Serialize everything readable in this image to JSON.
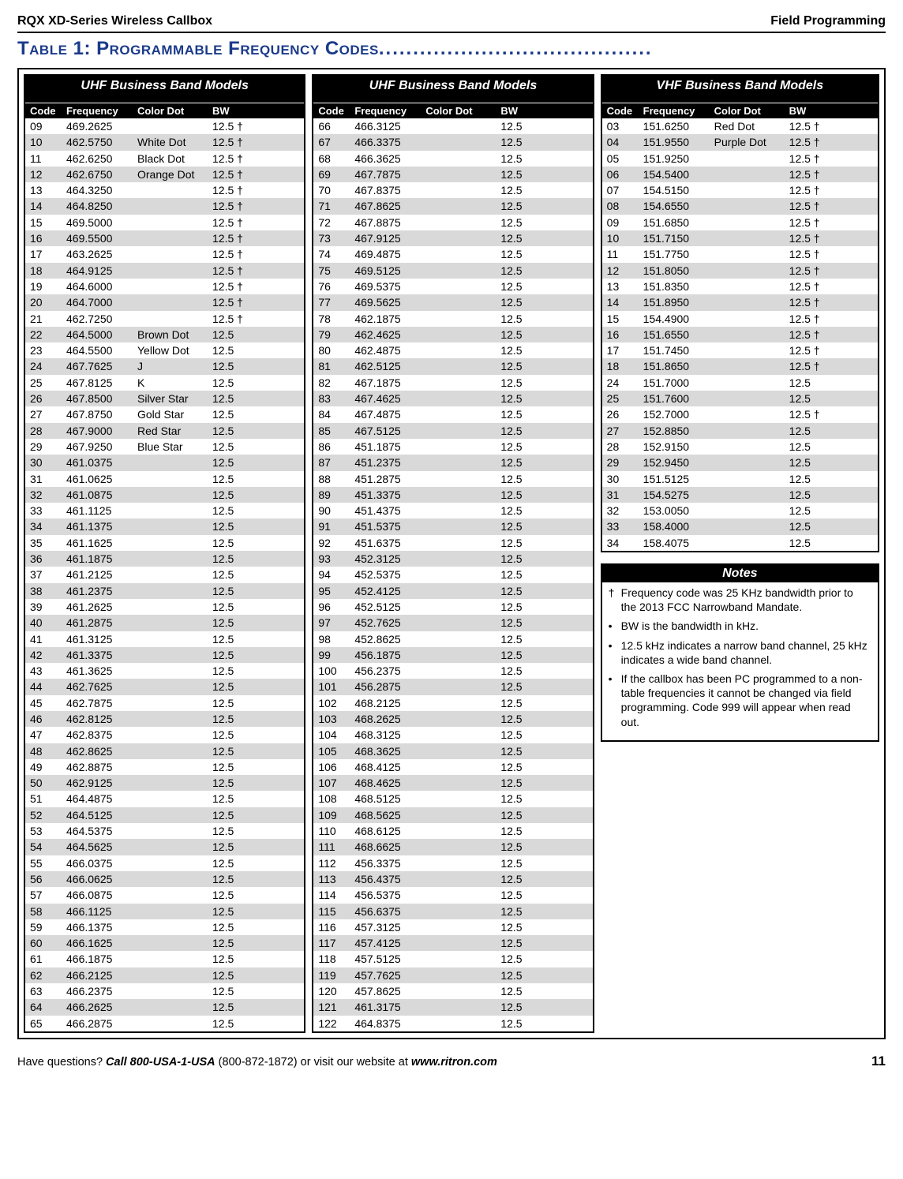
{
  "header": {
    "left": "RQX XD-Series Wireless Callbox",
    "right": "Field Programming"
  },
  "title": "Table 1: Programmable Frequency Codes",
  "dots": "........................................",
  "tables": {
    "headers": [
      "Code",
      "Frequency",
      "Color Dot",
      "BW"
    ],
    "col1": {
      "title": "UHF Business Band Models",
      "rows": [
        [
          "09",
          "469.2625",
          "",
          "12.5 †"
        ],
        [
          "10",
          "462.5750",
          "White Dot",
          "12.5 †"
        ],
        [
          "11",
          "462.6250",
          "Black Dot",
          "12.5 †"
        ],
        [
          "12",
          "462.6750",
          "Orange Dot",
          "12.5 †"
        ],
        [
          "13",
          "464.3250",
          "",
          "12.5 †"
        ],
        [
          "14",
          "464.8250",
          "",
          "12.5 †"
        ],
        [
          "15",
          "469.5000",
          "",
          "12.5 †"
        ],
        [
          "16",
          "469.5500",
          "",
          "12.5 †"
        ],
        [
          "17",
          "463.2625",
          "",
          "12.5 †"
        ],
        [
          "18",
          "464.9125",
          "",
          "12.5 †"
        ],
        [
          "19",
          "464.6000",
          "",
          "12.5 †"
        ],
        [
          "20",
          "464.7000",
          "",
          "12.5 †"
        ],
        [
          "21",
          "462.7250",
          "",
          "12.5 †"
        ],
        [
          "22",
          "464.5000",
          "Brown Dot",
          "12.5"
        ],
        [
          "23",
          "464.5500",
          "Yellow Dot",
          "12.5"
        ],
        [
          "24",
          "467.7625",
          "J",
          "12.5"
        ],
        [
          "25",
          "467.8125",
          "K",
          "12.5"
        ],
        [
          "26",
          "467.8500",
          "Silver Star",
          "12.5"
        ],
        [
          "27",
          "467.8750",
          "Gold Star",
          "12.5"
        ],
        [
          "28",
          "467.9000",
          "Red Star",
          "12.5"
        ],
        [
          "29",
          "467.9250",
          "Blue Star",
          "12.5"
        ],
        [
          "30",
          "461.0375",
          "",
          "12.5"
        ],
        [
          "31",
          "461.0625",
          "",
          "12.5"
        ],
        [
          "32",
          "461.0875",
          "",
          "12.5"
        ],
        [
          "33",
          "461.1125",
          "",
          "12.5"
        ],
        [
          "34",
          "461.1375",
          "",
          "12.5"
        ],
        [
          "35",
          "461.1625",
          "",
          "12.5"
        ],
        [
          "36",
          "461.1875",
          "",
          "12.5"
        ],
        [
          "37",
          "461.2125",
          "",
          "12.5"
        ],
        [
          "38",
          "461.2375",
          "",
          "12.5"
        ],
        [
          "39",
          "461.2625",
          "",
          "12.5"
        ],
        [
          "40",
          "461.2875",
          "",
          "12.5"
        ],
        [
          "41",
          "461.3125",
          "",
          "12.5"
        ],
        [
          "42",
          "461.3375",
          "",
          "12.5"
        ],
        [
          "43",
          "461.3625",
          "",
          "12.5"
        ],
        [
          "44",
          "462.7625",
          "",
          "12.5"
        ],
        [
          "45",
          "462.7875",
          "",
          "12.5"
        ],
        [
          "46",
          "462.8125",
          "",
          "12.5"
        ],
        [
          "47",
          "462.8375",
          "",
          "12.5"
        ],
        [
          "48",
          "462.8625",
          "",
          "12.5"
        ],
        [
          "49",
          "462.8875",
          "",
          "12.5"
        ],
        [
          "50",
          "462.9125",
          "",
          "12.5"
        ],
        [
          "51",
          "464.4875",
          "",
          "12.5"
        ],
        [
          "52",
          "464.5125",
          "",
          "12.5"
        ],
        [
          "53",
          "464.5375",
          "",
          "12.5"
        ],
        [
          "54",
          "464.5625",
          "",
          "12.5"
        ],
        [
          "55",
          "466.0375",
          "",
          "12.5"
        ],
        [
          "56",
          "466.0625",
          "",
          "12.5"
        ],
        [
          "57",
          "466.0875",
          "",
          "12.5"
        ],
        [
          "58",
          "466.1125",
          "",
          "12.5"
        ],
        [
          "59",
          "466.1375",
          "",
          "12.5"
        ],
        [
          "60",
          "466.1625",
          "",
          "12.5"
        ],
        [
          "61",
          "466.1875",
          "",
          "12.5"
        ],
        [
          "62",
          "466.2125",
          "",
          "12.5"
        ],
        [
          "63",
          "466.2375",
          "",
          "12.5"
        ],
        [
          "64",
          "466.2625",
          "",
          "12.5"
        ],
        [
          "65",
          "466.2875",
          "",
          "12.5"
        ]
      ]
    },
    "col2": {
      "title": "UHF Business Band Models",
      "rows": [
        [
          "66",
          "466.3125",
          "",
          "12.5"
        ],
        [
          "67",
          "466.3375",
          "",
          "12.5"
        ],
        [
          "68",
          "466.3625",
          "",
          "12.5"
        ],
        [
          "69",
          "467.7875",
          "",
          "12.5"
        ],
        [
          "70",
          "467.8375",
          "",
          "12.5"
        ],
        [
          "71",
          "467.8625",
          "",
          "12.5"
        ],
        [
          "72",
          "467.8875",
          "",
          "12.5"
        ],
        [
          "73",
          "467.9125",
          "",
          "12.5"
        ],
        [
          "74",
          "469.4875",
          "",
          "12.5"
        ],
        [
          "75",
          "469.5125",
          "",
          "12.5"
        ],
        [
          "76",
          "469.5375",
          "",
          "12.5"
        ],
        [
          "77",
          "469.5625",
          "",
          "12.5"
        ],
        [
          "78",
          "462.1875",
          "",
          "12.5"
        ],
        [
          "79",
          "462.4625",
          "",
          "12.5"
        ],
        [
          "80",
          "462.4875",
          "",
          "12.5"
        ],
        [
          "81",
          "462.5125",
          "",
          "12.5"
        ],
        [
          "82",
          "467.1875",
          "",
          "12.5"
        ],
        [
          "83",
          "467.4625",
          "",
          "12.5"
        ],
        [
          "84",
          "467.4875",
          "",
          "12.5"
        ],
        [
          "85",
          "467.5125",
          "",
          "12.5"
        ],
        [
          "86",
          "451.1875",
          "",
          "12.5"
        ],
        [
          "87",
          "451.2375",
          "",
          "12.5"
        ],
        [
          "88",
          "451.2875",
          "",
          "12.5"
        ],
        [
          "89",
          "451.3375",
          "",
          "12.5"
        ],
        [
          "90",
          "451.4375",
          "",
          "12.5"
        ],
        [
          "91",
          "451.5375",
          "",
          "12.5"
        ],
        [
          "92",
          "451.6375",
          "",
          "12.5"
        ],
        [
          "93",
          "452.3125",
          "",
          "12.5"
        ],
        [
          "94",
          "452.5375",
          "",
          "12.5"
        ],
        [
          "95",
          "452.4125",
          "",
          "12.5"
        ],
        [
          "96",
          "452.5125",
          "",
          "12.5"
        ],
        [
          "97",
          "452.7625",
          "",
          "12.5"
        ],
        [
          "98",
          "452.8625",
          "",
          "12.5"
        ],
        [
          "99",
          "456.1875",
          "",
          "12.5"
        ],
        [
          "100",
          "456.2375",
          "",
          "12.5"
        ],
        [
          "101",
          "456.2875",
          "",
          "12.5"
        ],
        [
          "102",
          "468.2125",
          "",
          "12.5"
        ],
        [
          "103",
          "468.2625",
          "",
          "12.5"
        ],
        [
          "104",
          "468.3125",
          "",
          "12.5"
        ],
        [
          "105",
          "468.3625",
          "",
          "12.5"
        ],
        [
          "106",
          "468.4125",
          "",
          "12.5"
        ],
        [
          "107",
          "468.4625",
          "",
          "12.5"
        ],
        [
          "108",
          "468.5125",
          "",
          "12.5"
        ],
        [
          "109",
          "468.5625",
          "",
          "12.5"
        ],
        [
          "110",
          "468.6125",
          "",
          "12.5"
        ],
        [
          "111",
          "468.6625",
          "",
          "12.5"
        ],
        [
          "112",
          "456.3375",
          "",
          "12.5"
        ],
        [
          "113",
          "456.4375",
          "",
          "12.5"
        ],
        [
          "114",
          "456.5375",
          "",
          "12.5"
        ],
        [
          "115",
          "456.6375",
          "",
          "12.5"
        ],
        [
          "116",
          "457.3125",
          "",
          "12.5"
        ],
        [
          "117",
          "457.4125",
          "",
          "12.5"
        ],
        [
          "118",
          "457.5125",
          "",
          "12.5"
        ],
        [
          "119",
          "457.7625",
          "",
          "12.5"
        ],
        [
          "120",
          "457.8625",
          "",
          "12.5"
        ],
        [
          "121",
          "461.3175",
          "",
          "12.5"
        ],
        [
          "122",
          "464.8375",
          "",
          "12.5"
        ]
      ]
    },
    "col3": {
      "title": "VHF Business Band Models",
      "rows": [
        [
          "03",
          "151.6250",
          "Red Dot",
          "12.5 †"
        ],
        [
          "04",
          "151.9550",
          "Purple Dot",
          "12.5 †"
        ],
        [
          "05",
          "151.9250",
          "",
          "12.5 †"
        ],
        [
          "06",
          "154.5400",
          "",
          "12.5 †"
        ],
        [
          "07",
          "154.5150",
          "",
          "12.5 †"
        ],
        [
          "08",
          "154.6550",
          "",
          "12.5 †"
        ],
        [
          "09",
          "151.6850",
          "",
          "12.5 †"
        ],
        [
          "10",
          "151.7150",
          "",
          "12.5 †"
        ],
        [
          "11",
          "151.7750",
          "",
          "12.5 †"
        ],
        [
          "12",
          "151.8050",
          "",
          "12.5 †"
        ],
        [
          "13",
          "151.8350",
          "",
          "12.5 †"
        ],
        [
          "14",
          "151.8950",
          "",
          "12.5 †"
        ],
        [
          "15",
          "154.4900",
          "",
          "12.5 †"
        ],
        [
          "16",
          "151.6550",
          "",
          "12.5 †"
        ],
        [
          "17",
          "151.7450",
          "",
          "12.5 †"
        ],
        [
          "18",
          "151.8650",
          "",
          "12.5 †"
        ],
        [
          "24",
          "151.7000",
          "",
          "12.5"
        ],
        [
          "25",
          "151.7600",
          "",
          "12.5"
        ],
        [
          "26",
          "152.7000",
          "",
          "12.5 †"
        ],
        [
          "27",
          "152.8850",
          "",
          "12.5"
        ],
        [
          "28",
          "152.9150",
          "",
          "12.5"
        ],
        [
          "29",
          "152.9450",
          "",
          "12.5"
        ],
        [
          "30",
          "151.5125",
          "",
          "12.5"
        ],
        [
          "31",
          "154.5275",
          "",
          "12.5"
        ],
        [
          "32",
          "153.0050",
          "",
          "12.5"
        ],
        [
          "33",
          "158.4000",
          "",
          "12.5"
        ],
        [
          "34",
          "158.4075",
          "",
          "12.5"
        ]
      ]
    }
  },
  "notes": {
    "title": "Notes",
    "items": [
      {
        "sym": "†",
        "text": "Frequency code was 25 KHz bandwidth prior to the 2013 FCC Narrowband Mandate."
      },
      {
        "sym": "•",
        "text": "BW is the bandwidth in kHz."
      },
      {
        "sym": "•",
        "text": "12.5 kHz indicates a narrow band channel, 25 kHz indicates a wide band channel."
      },
      {
        "sym": "•",
        "text": "If the callbox has been PC programmed to a non-table frequencies it cannot be changed via field programming. Code 999 will appear when read out."
      }
    ]
  },
  "footer": {
    "q": "Have questions?",
    "call": "Call 800-USA-1-USA",
    "num": "(800-872-1872) or visit our website at ",
    "site": "www.ritron.com",
    "page": "11"
  }
}
